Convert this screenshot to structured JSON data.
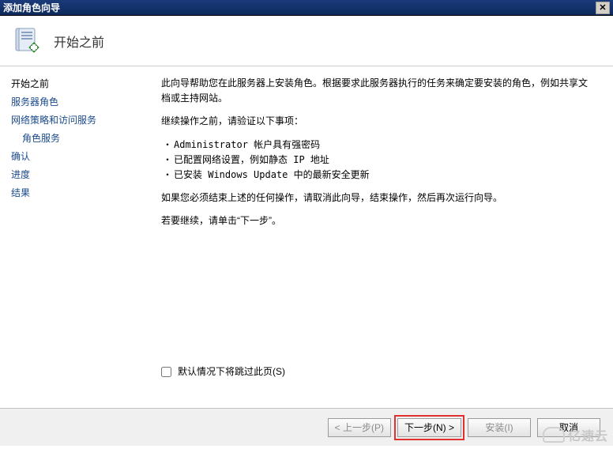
{
  "window": {
    "title": "添加角色向导",
    "close_glyph": "✕"
  },
  "header": {
    "title": "开始之前"
  },
  "sidebar": {
    "items": [
      {
        "label": "开始之前",
        "selected": true,
        "indent": false
      },
      {
        "label": "服务器角色",
        "selected": false,
        "indent": false
      },
      {
        "label": "网络策略和访问服务",
        "selected": false,
        "indent": false
      },
      {
        "label": "角色服务",
        "selected": false,
        "indent": true
      },
      {
        "label": "确认",
        "selected": false,
        "indent": false
      },
      {
        "label": "进度",
        "selected": false,
        "indent": false
      },
      {
        "label": "结果",
        "selected": false,
        "indent": false
      }
    ]
  },
  "main": {
    "intro": "此向导帮助您在此服务器上安装角色。根据要求此服务器执行的任务来确定要安装的角色，例如共享文档或主持网站。",
    "verify_heading": "继续操作之前，请验证以下事项：",
    "bullets": [
      "Administrator 帐户具有强密码",
      "已配置网络设置，例如静态 IP 地址",
      "已安装 Windows Update 中的最新安全更新"
    ],
    "cancel_hint": "如果您必须结束上述的任何操作，请取消此向导，结束操作，然后再次运行向导。",
    "continue_hint": "若要继续，请单击“下一步”。",
    "skip_checkbox_label": "默认情况下将跳过此页(S)"
  },
  "footer": {
    "prev": "< 上一步(P)",
    "next": "下一步(N) >",
    "install": "安装(I)",
    "cancel": "取消"
  },
  "watermark": {
    "text": "亿速云"
  }
}
